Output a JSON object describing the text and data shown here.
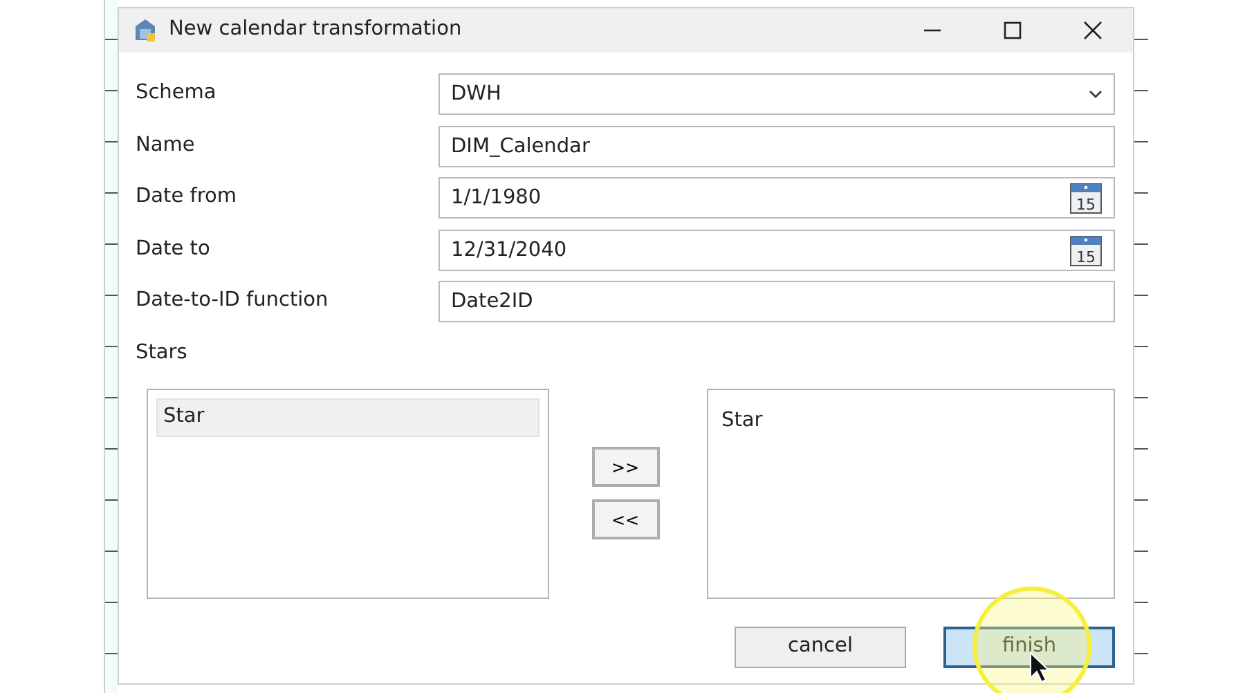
{
  "window": {
    "title": "New calendar transformation"
  },
  "fields": [
    {
      "kind": "select",
      "label": "Schema",
      "value": "DWH"
    },
    {
      "kind": "text",
      "label": "Name",
      "value": "DIM_Calendar"
    },
    {
      "kind": "date",
      "label": "Date from",
      "value": "1/1/1980",
      "icon_text": "15"
    },
    {
      "kind": "date",
      "label": "Date to",
      "value": "12/31/2040",
      "icon_text": "15"
    },
    {
      "kind": "text",
      "label": "Date-to-ID function",
      "value": "Date2ID"
    }
  ],
  "stars": {
    "label": "Stars",
    "available": [
      {
        "label": "Star",
        "selected": true
      }
    ],
    "chosen": [
      {
        "label": "Star",
        "selected": false
      }
    ],
    "move_buttons": [
      ">>",
      "<<"
    ]
  },
  "buttons": [
    {
      "label": "cancel",
      "default": false
    },
    {
      "label": "finish",
      "default": true
    }
  ]
}
